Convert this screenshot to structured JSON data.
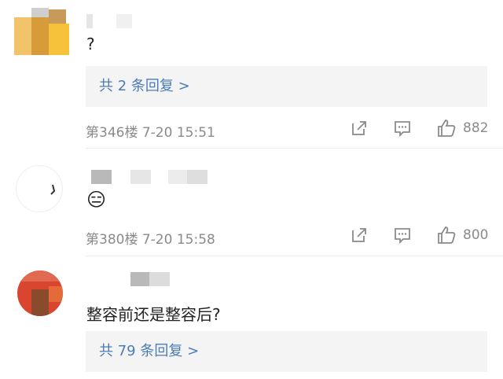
{
  "comments": [
    {
      "text": "?",
      "replies_label": "共 2 条回复 >",
      "meta": "第346楼 7-20 15:51",
      "likes": "882",
      "share_icon": "share-icon",
      "reply_icon": "comment-icon",
      "like_icon": "thumbs-up-icon"
    },
    {
      "text": "😑",
      "meta": "第380楼 7-20 15:58",
      "likes": "800",
      "share_icon": "share-icon",
      "reply_icon": "comment-icon",
      "like_icon": "thumbs-up-icon"
    },
    {
      "text": "整容前还是整容后?",
      "replies_label": "共 79 条回复 >"
    }
  ],
  "colors": {
    "link": "#4a7cb5",
    "meta": "#8a8a8a",
    "reply_bg": "#f4f4f4"
  }
}
